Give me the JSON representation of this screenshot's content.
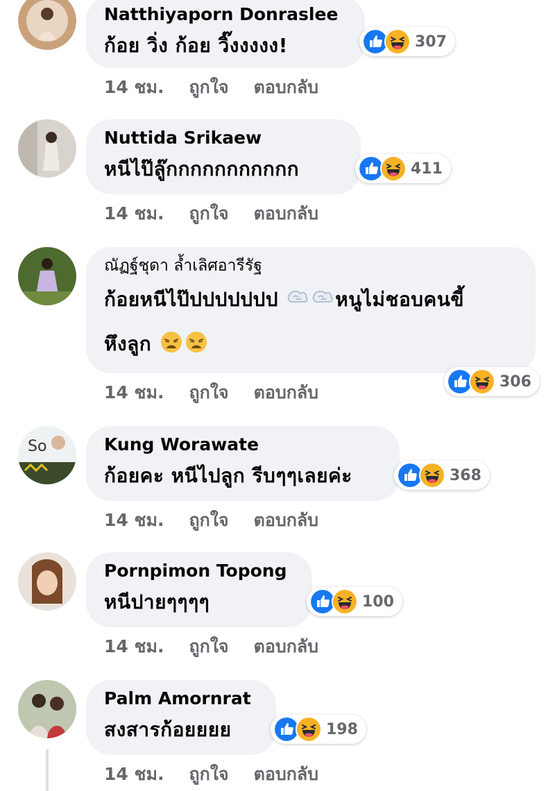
{
  "comments": [
    {
      "name": "Natthiyaporn Donraslee",
      "text": "ก้อย วิ่ง ก้อย วิ๊งงงงง!",
      "reaction_count": "307",
      "time": "14 ชม.",
      "like": "ถูกใจ",
      "reply": "ตอบกลับ"
    },
    {
      "name": "Nuttida Srikaew",
      "text": "หนีไป๊ลู๊กกกกกกกกกกก",
      "reaction_count": "411",
      "time": "14 ชม.",
      "like": "ถูกใจ",
      "reply": "ตอบกลับ"
    },
    {
      "name": "ณัฏฐ์ชุดา ล้ำเลิศอารีรัฐ",
      "text_a": "ก้อยหนีไป๊ปปปปปปป",
      "text_b": "หนูไม่ชอบคนขี้",
      "text_c": "หึงลูก",
      "reaction_count": "306",
      "time": "14 ชม.",
      "like": "ถูกใจ",
      "reply": "ตอบกลับ"
    },
    {
      "name": "Kung Worawate",
      "text": "ก้อยคะ หนีไปลูก รีบๆๆเลยค่ะ",
      "reaction_count": "368",
      "time": "14 ชม.",
      "like": "ถูกใจ",
      "reply": "ตอบกลับ"
    },
    {
      "name": "Pornpimon Topong",
      "text": "หนีปายๆๆๆๆ",
      "reaction_count": "100",
      "time": "14 ชม.",
      "like": "ถูกใจ",
      "reply": "ตอบกลับ"
    },
    {
      "name": "Palm Amornrat",
      "text": "สงสารก้อยยยย",
      "reaction_count": "198",
      "time": "14 ชม.",
      "like": "ถูกใจ",
      "reply": "ตอบกลับ"
    }
  ],
  "icons": {
    "like": "like-reaction-icon",
    "haha": "haha-reaction-icon",
    "dash": "dashing-away-emoji",
    "weary": "weary-face-emoji"
  },
  "colors": {
    "bubble": "#f0f2f5",
    "like_blue": "#1877f2",
    "haha_yellow": "#f7b125",
    "meta_gray": "#65676b"
  }
}
